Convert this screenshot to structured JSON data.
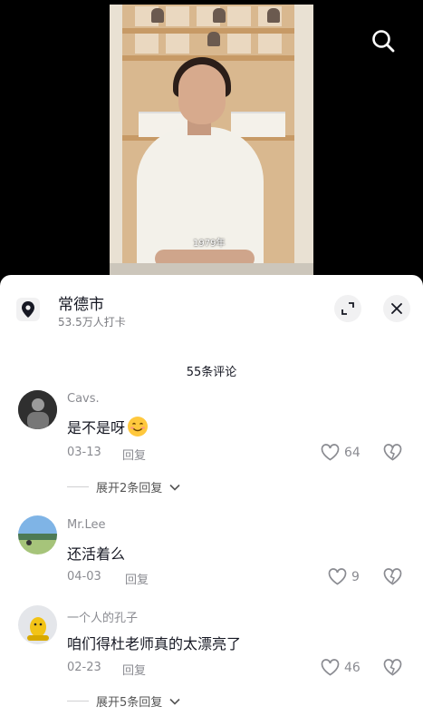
{
  "video": {
    "caption": "1979年"
  },
  "location": {
    "name": "常德市",
    "checkins": "53.5万人打卡"
  },
  "comments_header": {
    "title": "55条评论"
  },
  "comments": [
    {
      "user": "Cavs.",
      "text": "是不是呀",
      "emoji": "smiling-face-emoji",
      "date": "03-13",
      "reply_label": "回复",
      "likes": "64",
      "expand_label": "展开2条回复"
    },
    {
      "user": "Mr.Lee",
      "text": "还活着么",
      "date": "04-03",
      "reply_label": "回复",
      "likes": "9"
    },
    {
      "user": "一个人的孔子",
      "text": "咱们得杜老师真的太漂亮了",
      "date": "02-23",
      "reply_label": "回复",
      "likes": "46",
      "expand_label": "展开5条回复"
    }
  ],
  "icons": [
    "search-icon",
    "location-pin-icon",
    "expand-icon",
    "close-icon",
    "heart-icon",
    "broken-heart-icon",
    "chevron-down-icon"
  ],
  "colors": {
    "text": "#161823",
    "muted": "#8a8b91",
    "panel": "#ffffff",
    "background": "#000000"
  }
}
